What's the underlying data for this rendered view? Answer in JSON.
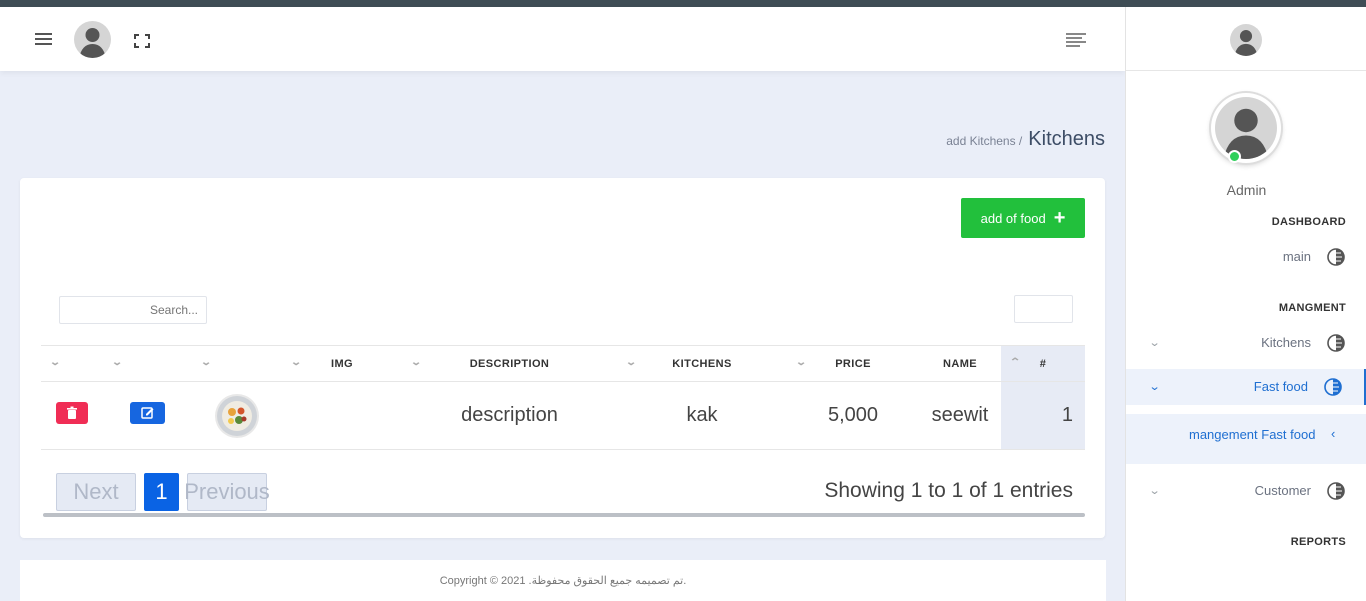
{
  "sidebar": {
    "user_name": "Admin",
    "section_dashboard": "DASHBOARD",
    "section_management": "MANGMENT",
    "section_reports": "REPORTS",
    "items": [
      {
        "label": "main"
      },
      {
        "label": "Kitchens"
      },
      {
        "label": "Fast food"
      },
      {
        "label": "Customer"
      }
    ],
    "submenu_label": "mangement Fast food",
    "accent_color": "#1f6fd1"
  },
  "breadcrumb": {
    "link": "add Kitchens /",
    "title": "Kitchens"
  },
  "toolbar": {
    "add_label": "add of food",
    "add_icon": "+",
    "search_placeholder": "Search..."
  },
  "table": {
    "headers": [
      "#",
      "NAME",
      "PRICE",
      "KITCHENS",
      "DESCRIPTION",
      "IMG"
    ],
    "rows": [
      {
        "num": "1",
        "name": "seewit",
        "price": "5,000",
        "kitchen": "kak",
        "description": "description"
      }
    ]
  },
  "pagination": {
    "next": "Next",
    "current": "1",
    "previous": "Previous",
    "info": "Showing 1 to 1 of 1 entries"
  },
  "footer": {
    "text": "Copyright © 2021 .تم تصميمه جميع الحقوق محفوظة."
  },
  "colors": {
    "success": "#22c03c",
    "danger": "#f02d55",
    "primary": "#1666e0"
  }
}
